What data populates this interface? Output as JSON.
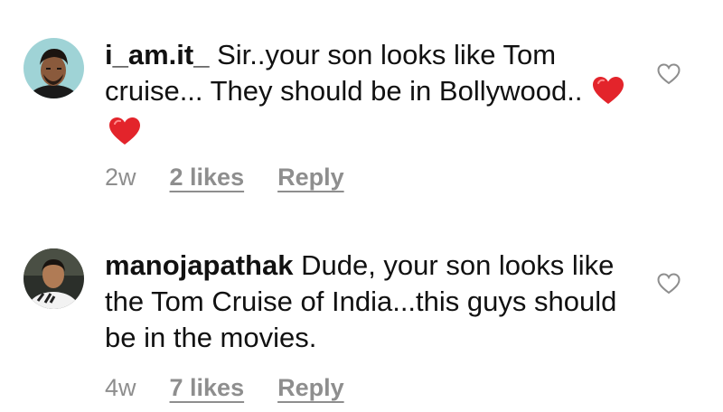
{
  "comments": [
    {
      "username": "i_am.it_",
      "text": "Sir..your son looks like Tom cruise... They should be in Bollywood..",
      "emojis": [
        "red-heart",
        "red-heart"
      ],
      "time": "2w",
      "likes": "2 likes",
      "reply": "Reply"
    },
    {
      "username": "manojapathak",
      "text": "Dude, your son looks like the Tom Cruise of India...this guys should be in the movies.",
      "emojis": [],
      "time": "4w",
      "likes": "7 likes",
      "reply": "Reply"
    }
  ],
  "icons": {
    "like": "heart-outline-icon",
    "emoji": "red-heart-emoji"
  },
  "colors": {
    "text": "#111111",
    "muted": "#8e8e8e",
    "heart_emoji": "#e3242b"
  }
}
